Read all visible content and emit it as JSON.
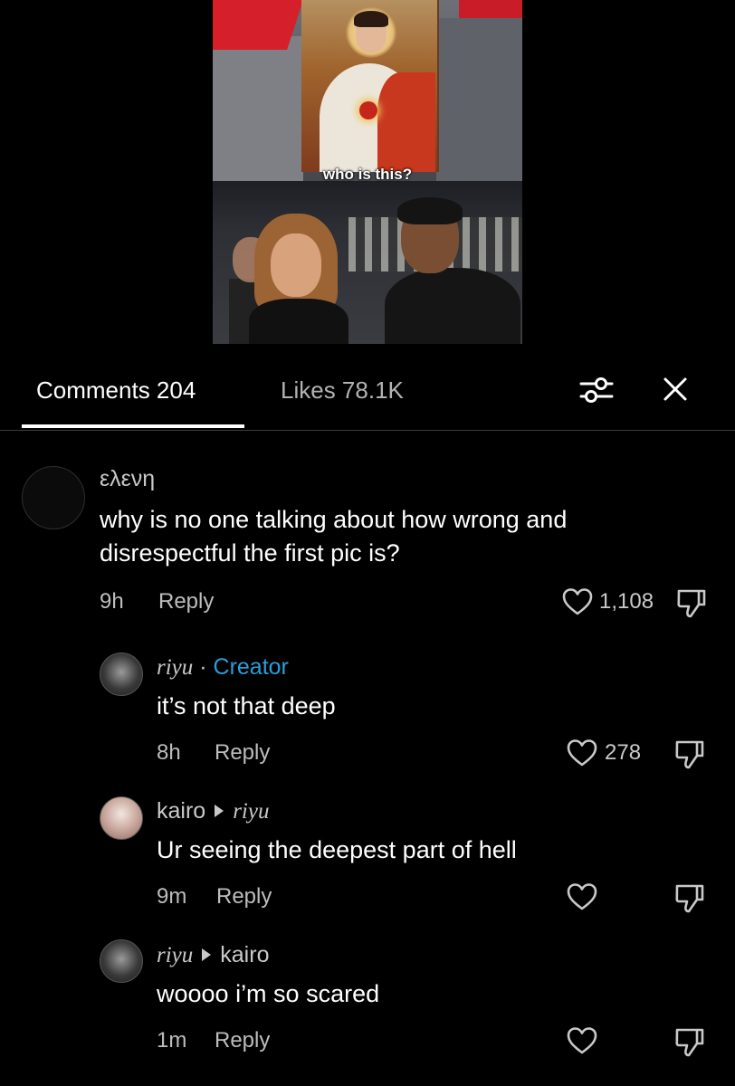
{
  "video": {
    "caption": "who is this?"
  },
  "tabs": {
    "comments_label": "Comments 204",
    "likes_label": "Likes 78.1K"
  },
  "icons": {
    "filter": "filter-sliders-icon",
    "close": "close-icon",
    "heart": "heart-outline-icon",
    "dislike": "thumbs-down-icon"
  },
  "colors": {
    "background": "#000000",
    "creator_badge": "#2a9fd8",
    "muted_text": "#bdbdbd"
  },
  "comments": [
    {
      "username": "ελενη",
      "text_line1": "why is no one talking about how wrong and",
      "text_line2": "disrespectful the first pic is?",
      "time": "9h",
      "reply_label": "Reply",
      "likes": "1,108"
    },
    {
      "username": "riyu",
      "separator": "·",
      "badge": "Creator",
      "text": "it’s not that deep",
      "time": "8h",
      "reply_label": "Reply",
      "likes": "278"
    },
    {
      "username": "kairo",
      "reply_to": "riyu",
      "text": "Ur seeing the deepest part of hell",
      "time": "9m",
      "reply_label": "Reply"
    },
    {
      "username": "riyu",
      "reply_to": "kairo",
      "text": "woooo i’m so scared",
      "time": "1m",
      "reply_label": "Reply"
    }
  ]
}
